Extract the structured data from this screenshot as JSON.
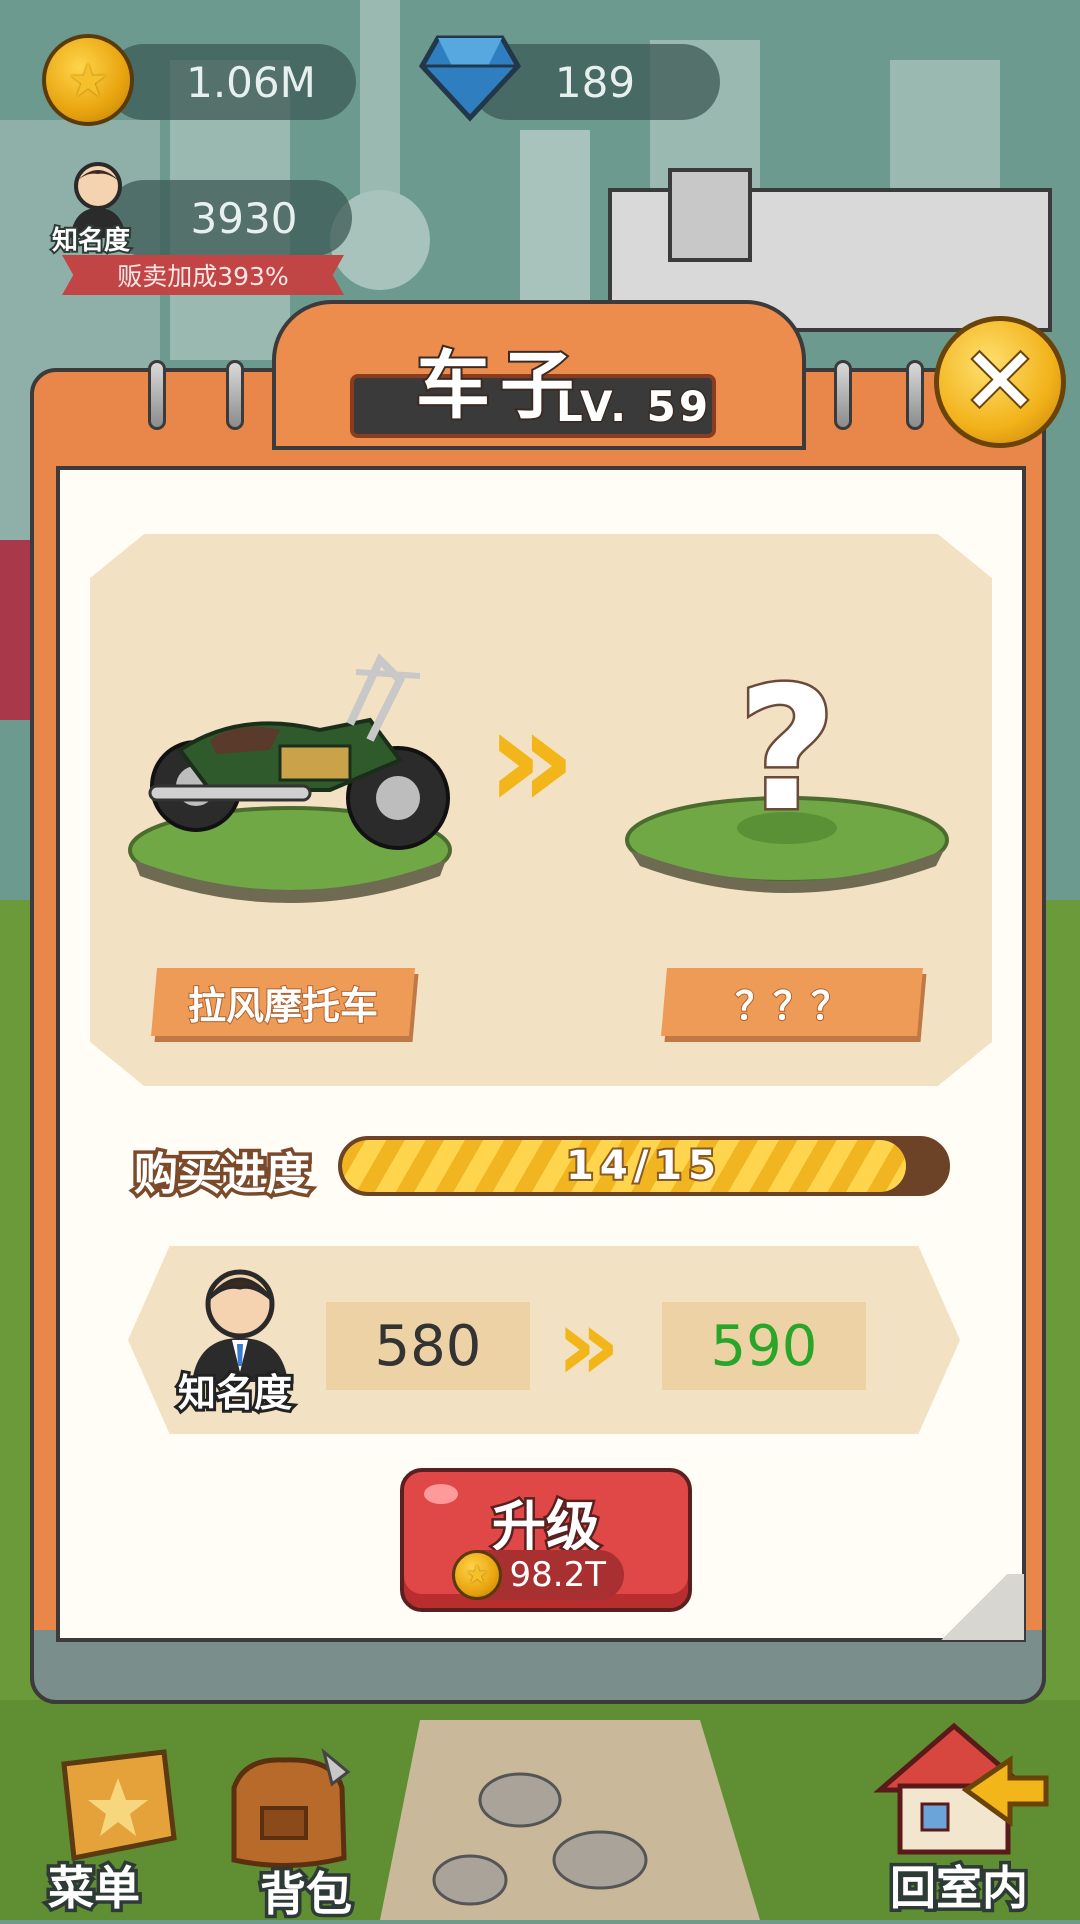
{
  "hud": {
    "coins": "1.06M",
    "gems": "189",
    "fame_value": "3930",
    "fame_label": "知名度",
    "sales_bonus": "贩卖加成393%"
  },
  "panel": {
    "title": "车子",
    "level": "LV. 59",
    "close_icon": "✕"
  },
  "showcase": {
    "current_name": "拉风摩托车",
    "next_name": "？？？",
    "arrow": "»",
    "unknown_symbol": "?"
  },
  "progress": {
    "label": "购买进度",
    "text": "14/15",
    "current": 14,
    "total": 15
  },
  "fame": {
    "label": "知名度",
    "from": "580",
    "to": "590",
    "to_color": "#2aa52a"
  },
  "upgrade": {
    "label": "升级",
    "cost": "98.2T"
  },
  "nav": {
    "menu_label": "菜单",
    "bag_label": "背包",
    "home_label": "回室内"
  },
  "colors": {
    "accent_orange": "#e9874a",
    "button_red": "#e04848",
    "gold": "#f2b51a"
  }
}
